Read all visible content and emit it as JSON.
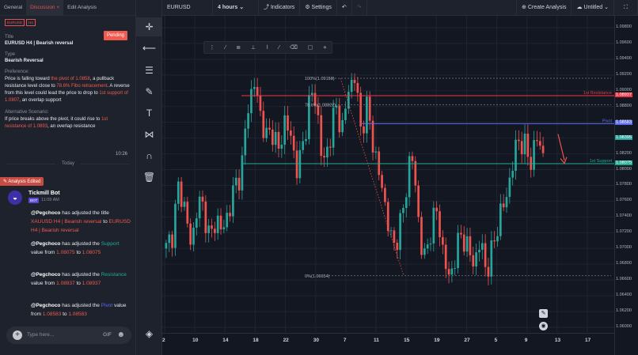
{
  "tabs": {
    "general": "General",
    "discussion": "Discussion",
    "discussion_close": "×",
    "edit": "Edit Analysis"
  },
  "detail": {
    "tag1": "EURUSD",
    "tag2": "H4",
    "status": "Pending",
    "title_label": "Title",
    "title": "EURUSD H4 | Bearish reversal",
    "type_label": "Type",
    "type": "Bearish Reversal",
    "pref_label": "Preference:",
    "pref_1": "Price is falling toward ",
    "pref_2": "the pivot of 1.0858",
    "pref_3": ", a pullback resistance level close to ",
    "pref_4": "78.6% Fibo retracement",
    "pref_5": ". A reverse from this level could lead the price to drop to ",
    "pref_6": "1st support of 1.0807",
    "pref_7": ", an overlap support",
    "alt_label": "Alternative Scenario:",
    "alt_1": "If price breaks above the pivot, it could rise to ",
    "alt_2": "1st resistance of 1.0893",
    "alt_3": ", an overlap resistance",
    "time": "10:26"
  },
  "chat": {
    "today": "Today",
    "edited": "Analysis Edited",
    "bot_name": "Tickmill Bot",
    "bot_badge": "BOT",
    "bot_time": "11:09 AM",
    "m1": {
      "user": "@Pegchoco",
      "a": " has adjusted the title ",
      "old": "XAUUSD H4 | Bearish reversal",
      "to": " to ",
      "new": "EURUSD H4 | Bearish reversal"
    },
    "m2": {
      "user": "@Pegchoco",
      "a": " has adjusted the ",
      "field": "Support",
      "b": " value from ",
      "old": "1.08075",
      "to": " to ",
      "new": "1.08075"
    },
    "m3": {
      "user": "@Pegchoco",
      "a": " has adjusted the ",
      "field": "Resistance",
      "b": " value from ",
      "old": "1.08937",
      "to": " to ",
      "new": "1.08937"
    },
    "m4": {
      "user": "@Pegchoco",
      "a": " has adjusted the ",
      "field": "Pivot",
      "b": " value from ",
      "old": "1.08583",
      "to": " to ",
      "new": "1.08583"
    },
    "placeholder": "Type here...",
    "gif": "GIF"
  },
  "topbar": {
    "symbol": "EURUSD",
    "interval": "4 hours",
    "indicators": "Indicators",
    "settings": "Settings",
    "create": "Create Analysis",
    "untitled": "Untitled"
  },
  "colors": {
    "resistance": "#f23645",
    "pivot": "#5b6bf0",
    "support": "#22ab94",
    "up": "#26a69a",
    "down": "#ef5350"
  },
  "chart_data": {
    "type": "candlestick",
    "symbol": "EURUSD",
    "interval": "4 hours",
    "ylim": [
      1.0594,
      1.0995
    ],
    "yticks": [
      "1.09800",
      "1.09600",
      "1.09400",
      "1.09200",
      "1.09000",
      "1.08800",
      "1.08600",
      "1.08400",
      "1.08200",
      "1.08000",
      "1.07800",
      "1.07600",
      "1.07400",
      "1.07200",
      "1.07000",
      "1.06800",
      "1.06600",
      "1.06400",
      "1.06200",
      "1.06000"
    ],
    "xticks": [
      "2",
      "10",
      "14",
      "18",
      "22",
      "30",
      "7",
      "11",
      "15",
      "19",
      "27",
      "5",
      "9",
      "13",
      "17"
    ],
    "levels": [
      {
        "name": "1st Resistance",
        "value": 1.08937,
        "label": "1.08937"
      },
      {
        "name": "Pivot",
        "value": 1.08583,
        "label": "1.08583"
      },
      {
        "name": "1st Support",
        "value": 1.08075,
        "label": "1.08075"
      }
    ],
    "current_price": "1.08395",
    "fib": [
      {
        "label": "100%(1.09158)",
        "value": 1.09158
      },
      {
        "label": "78.6%(1.08822)",
        "value": 1.08822
      },
      {
        "label": "0%(1.06654)",
        "value": 1.06654
      }
    ],
    "path": [
      1.07,
      1.072,
      1.078,
      1.075,
      1.07,
      1.076,
      1.075,
      1.071,
      1.074,
      1.072,
      1.075,
      1.078,
      1.08,
      1.088,
      1.091,
      1.087,
      1.084,
      1.085,
      1.082,
      1.087,
      1.083,
      1.08,
      1.084,
      1.09,
      1.088,
      1.08,
      1.084,
      1.088,
      1.085,
      1.09,
      1.092,
      1.085,
      1.088,
      1.083,
      1.079,
      1.075,
      1.07,
      1.072,
      1.076,
      1.083,
      1.075,
      1.068,
      1.072,
      1.075,
      1.07,
      1.066,
      1.069,
      1.072,
      1.07,
      1.068,
      1.071,
      1.067,
      1.07,
      1.074,
      1.076,
      1.08,
      1.084,
      1.083,
      1.081,
      1.084,
      1.082
    ]
  }
}
